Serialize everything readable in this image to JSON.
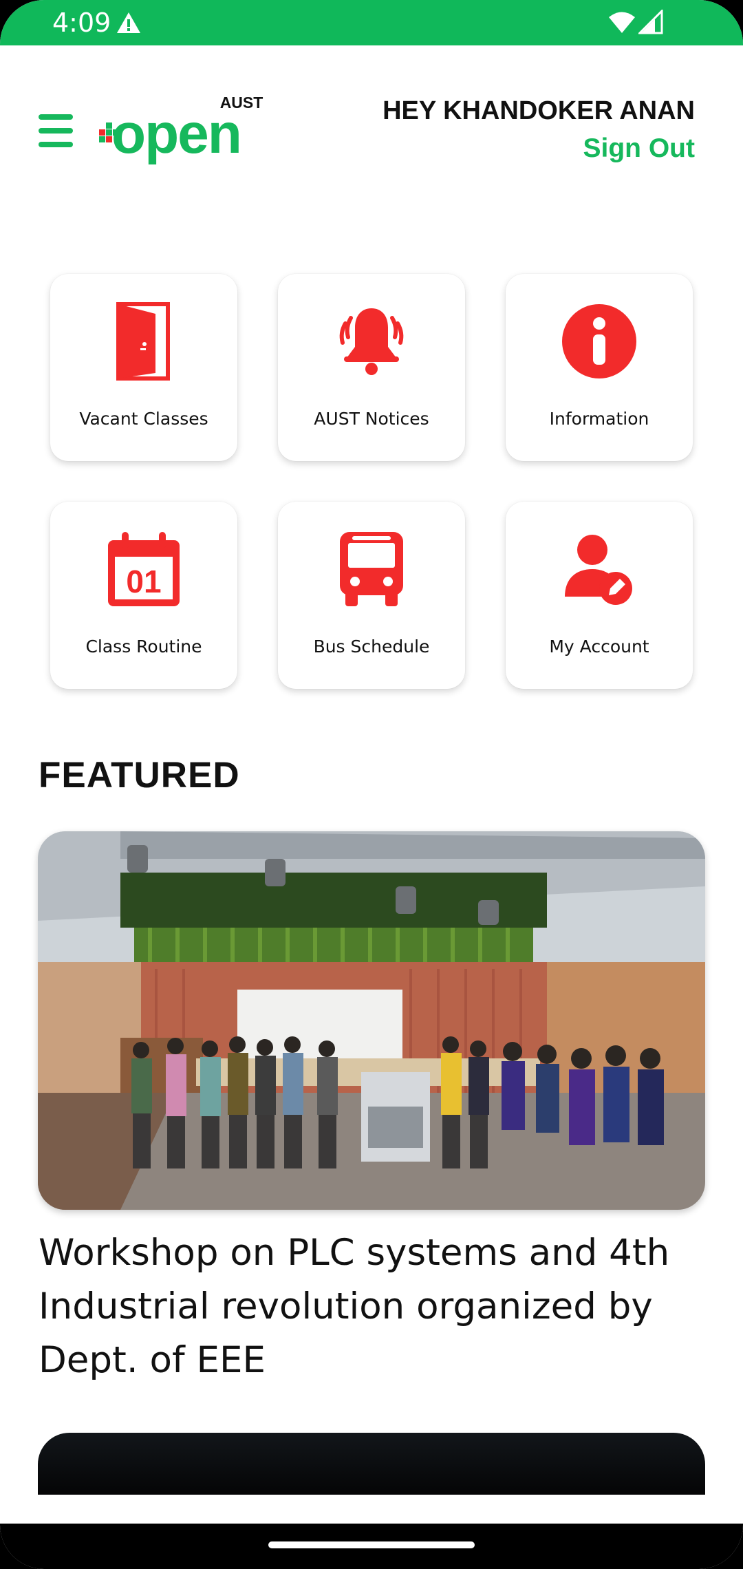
{
  "status_bar": {
    "time": "4:09",
    "icons": [
      "warning-icon",
      "wifi-icon",
      "signal-icon"
    ],
    "background": "#10b85a"
  },
  "header": {
    "logo_small": "AUST",
    "logo_main": "open",
    "greeting": "HEY KHANDOKER ANAN",
    "sign_out": "Sign Out",
    "accent": "#16b85c"
  },
  "tiles": [
    {
      "label": "Vacant Classes",
      "icon": "door-icon"
    },
    {
      "label": "AUST Notices",
      "icon": "bell-icon"
    },
    {
      "label": "Information",
      "icon": "info-icon"
    },
    {
      "label": "Class Routine",
      "icon": "calendar-icon",
      "icon_text": "01"
    },
    {
      "label": "Bus Schedule",
      "icon": "bus-icon"
    },
    {
      "label": "My Account",
      "icon": "user-edit-icon"
    }
  ],
  "tile_icon_color": "#f22b2b",
  "featured": {
    "heading": "FEATURED",
    "caption": "Workshop on PLC systems and 4th Industrial revolution organized by Dept. of EEE"
  }
}
